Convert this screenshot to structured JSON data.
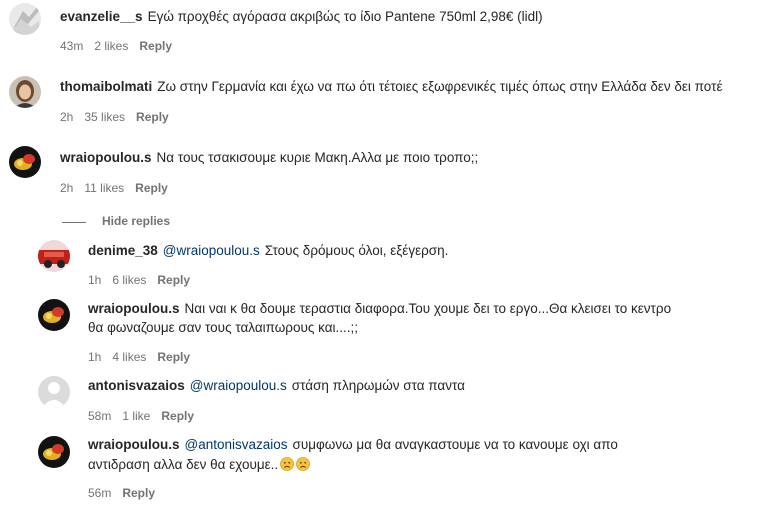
{
  "comments": [
    {
      "username": "evanzelie__s",
      "text": "Εγώ προχθές αγόρασα ακριβώς το ίδιο Pantene 750ml 2,98€ (lidl)",
      "time": "43m",
      "likes": "2 likes",
      "reply_label": "Reply"
    },
    {
      "username": "thomaibolmati",
      "text": "Ζω στην Γερμανία και έχω να πω ότι τέτοιες εξωφρενικές τιμές όπως στην Ελλάδα δεν δει ποτέ",
      "time": "2h",
      "likes": "35 likes",
      "reply_label": "Reply"
    },
    {
      "username": "wraiopoulou.s",
      "text": "Να τους τσακισουμε κυριε Μακη.Αλλα με ποιο τροπο;;",
      "time": "2h",
      "likes": "11 likes",
      "reply_label": "Reply"
    }
  ],
  "hide_replies_label": "Hide replies",
  "replies": [
    {
      "username": "denime_38",
      "mention": "@wraiopoulou.s",
      "text": "Στους δρόμους όλοι, εξέγερση.",
      "time": "1h",
      "likes": "6 likes",
      "reply_label": "Reply"
    },
    {
      "username": "wraiopoulou.s",
      "text": "Ναι ναι κ θα δουμε τεραστια διαφορα.Του χουμε δει το εργο...Θα κλεισει το κεντρο",
      "text_line2": "θα φωναζουμε σαν τους ταλαιπωρους και....;;",
      "time": "1h",
      "likes": "4 likes",
      "reply_label": "Reply"
    },
    {
      "username": "antonisvazaios",
      "mention": "@wraiopoulou.s",
      "text": "στάση πληρωμών στα παντα",
      "time": "58m",
      "likes": "1 like",
      "reply_label": "Reply"
    },
    {
      "username": "wraiopoulou.s",
      "mention": "@antonisvazaios",
      "text": "συμφωνω μα θα αναγκαστουμε να το κανουμε οχι απο",
      "text_line2": "αντιδραση αλλα δεν θα εχουμε..",
      "time": "56m",
      "reply_label": "Reply"
    }
  ],
  "colors": {
    "text": "#262626",
    "meta": "#737373",
    "mention": "#00376b",
    "background": "#ffffff"
  },
  "icons": [
    "avatar-evanzelie",
    "avatar-thomaibolmati",
    "avatar-wraiopoulou",
    "avatar-denime",
    "avatar-default",
    "disappointed-face-emoji"
  ]
}
